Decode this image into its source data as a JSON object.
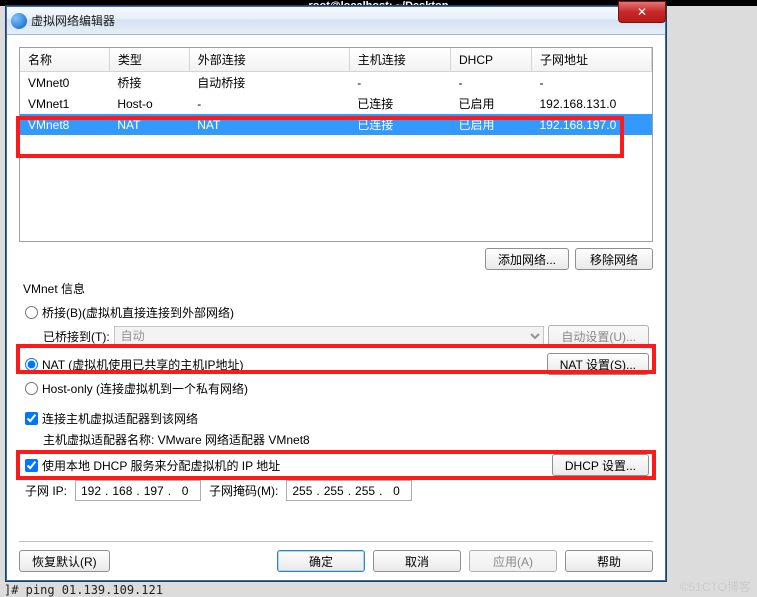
{
  "bg_title": "root@localhost: ~/Desktop",
  "window": {
    "title": "虚拟网络编辑器",
    "close": "✕"
  },
  "table": {
    "headers": [
      "名称",
      "类型",
      "外部连接",
      "主机连接",
      "DHCP",
      "子网地址"
    ],
    "rows": [
      {
        "cells": [
          "VMnet0",
          "桥接",
          "自动桥接",
          "-",
          "-",
          "-"
        ],
        "selected": false
      },
      {
        "cells": [
          "VMnet1",
          "Host-o",
          "-",
          "已连接",
          "已启用",
          "192.168.131.0"
        ],
        "selected": false
      },
      {
        "cells": [
          "VMnet8",
          "NAT",
          "NAT",
          "已连接",
          "已启用",
          "192.168.197.0"
        ],
        "selected": true
      }
    ]
  },
  "buttons": {
    "add_network": "添加网络...",
    "remove_network": "移除网络",
    "auto_settings": "自动设置(U)...",
    "nat_settings": "NAT 设置(S)...",
    "dhcp_settings": "DHCP 设置...",
    "restore_defaults": "恢复默认(R)",
    "ok": "确定",
    "cancel": "取消",
    "apply": "应用(A)",
    "help": "帮助"
  },
  "info": {
    "group_title": "VMnet 信息",
    "bridged_label": "桥接(B)(虚拟机直接连接到外部网络)",
    "bridged_to_label": "已桥接到(T):",
    "bridged_to_value": "自动",
    "nat_label": "NAT (虚拟机使用已共享的主机IP地址)",
    "hostonly_label": "Host-only (连接虚拟机到一个私有网络)",
    "connect_host_label": "连接主机虚拟适配器到该网络",
    "adapter_name_label": "主机虚拟适配器名称: VMware 网络适配器 VMnet8",
    "use_dhcp_label": "使用本地 DHCP 服务来分配虚拟机的 IP 地址",
    "subnet_ip_label": "子网 IP:",
    "subnet_ip": [
      "192",
      "168",
      "197",
      "0"
    ],
    "subnet_mask_label": "子网掩码(M):",
    "subnet_mask": [
      "255",
      "255",
      "255",
      "0"
    ]
  },
  "terminal_line": "]# ping 01.139.109.121",
  "watermark": "©51CTO博客"
}
